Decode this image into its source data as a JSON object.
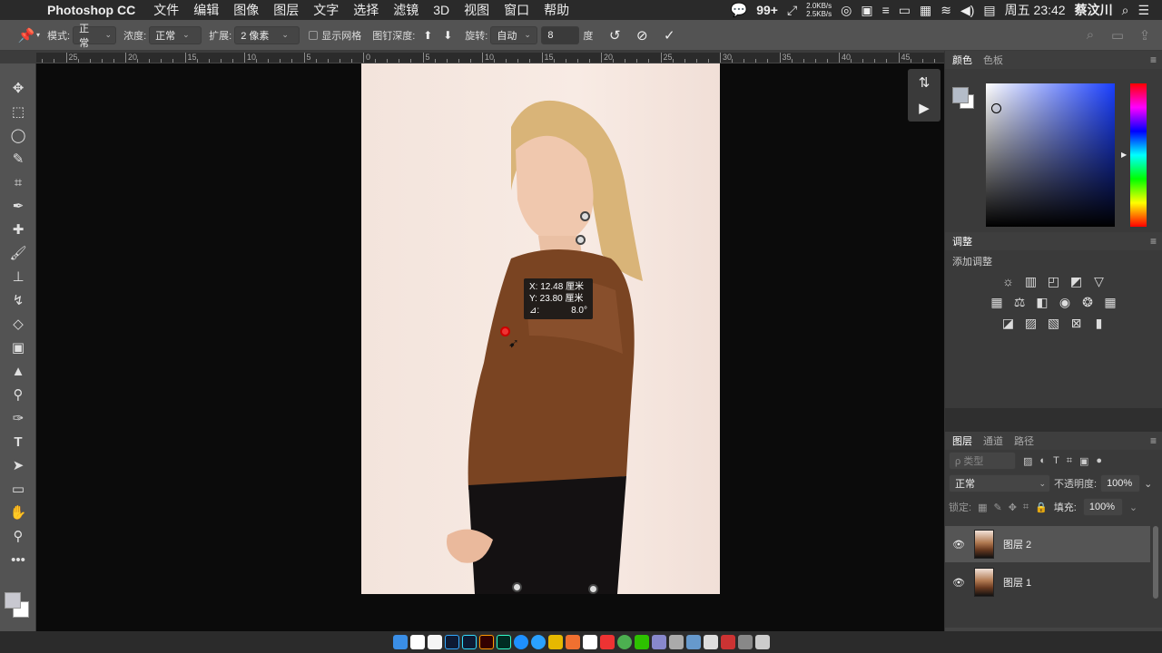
{
  "menubar": {
    "app_name": "Photoshop CC",
    "menus": [
      "文件",
      "编辑",
      "图像",
      "图层",
      "文字",
      "选择",
      "滤镜",
      "3D",
      "视图",
      "窗口",
      "帮助"
    ],
    "badge": "99+",
    "net_up": "2.0KB/s",
    "net_down": "2.5KB/s",
    "clock": "周五 23:42",
    "user": "蔡汶川"
  },
  "options": {
    "mode_label": "模式:",
    "mode_value": "正常",
    "density_label": "浓度:",
    "density_value": "正常",
    "expand_label": "扩展:",
    "expand_value": "2 像素",
    "show_mesh": "显示网格",
    "pin_depth": "图钉深度:",
    "rotate_label": "旋转:",
    "rotate_value": "自动",
    "angle_value": "8",
    "degree": "度"
  },
  "ruler": {
    "labels": [
      "25",
      "20",
      "15",
      "10",
      "5",
      "0",
      "5",
      "10",
      "15",
      "20",
      "25",
      "30",
      "35",
      "40",
      "45"
    ]
  },
  "tooltip": {
    "x": "X: 12.48 厘米",
    "y": "Y: 23.80 厘米",
    "angle_label": "⊿:",
    "angle_value": "8.0°"
  },
  "color_panel": {
    "tab_color": "颜色",
    "tab_swatches": "色板",
    "fg_color": "#b4bcc8"
  },
  "adjust_panel": {
    "title": "调整",
    "subtitle": "添加调整"
  },
  "layers_panel": {
    "tabs": [
      "图层",
      "通道",
      "路径"
    ],
    "filter_placeholder": "ρ 类型",
    "blend_mode": "正常",
    "opacity_label": "不透明度:",
    "opacity_value": "100%",
    "lock_label": "锁定:",
    "fill_label": "填充:",
    "fill_value": "100%",
    "layers": [
      {
        "name": "图层 2"
      },
      {
        "name": "图层 1"
      }
    ]
  }
}
